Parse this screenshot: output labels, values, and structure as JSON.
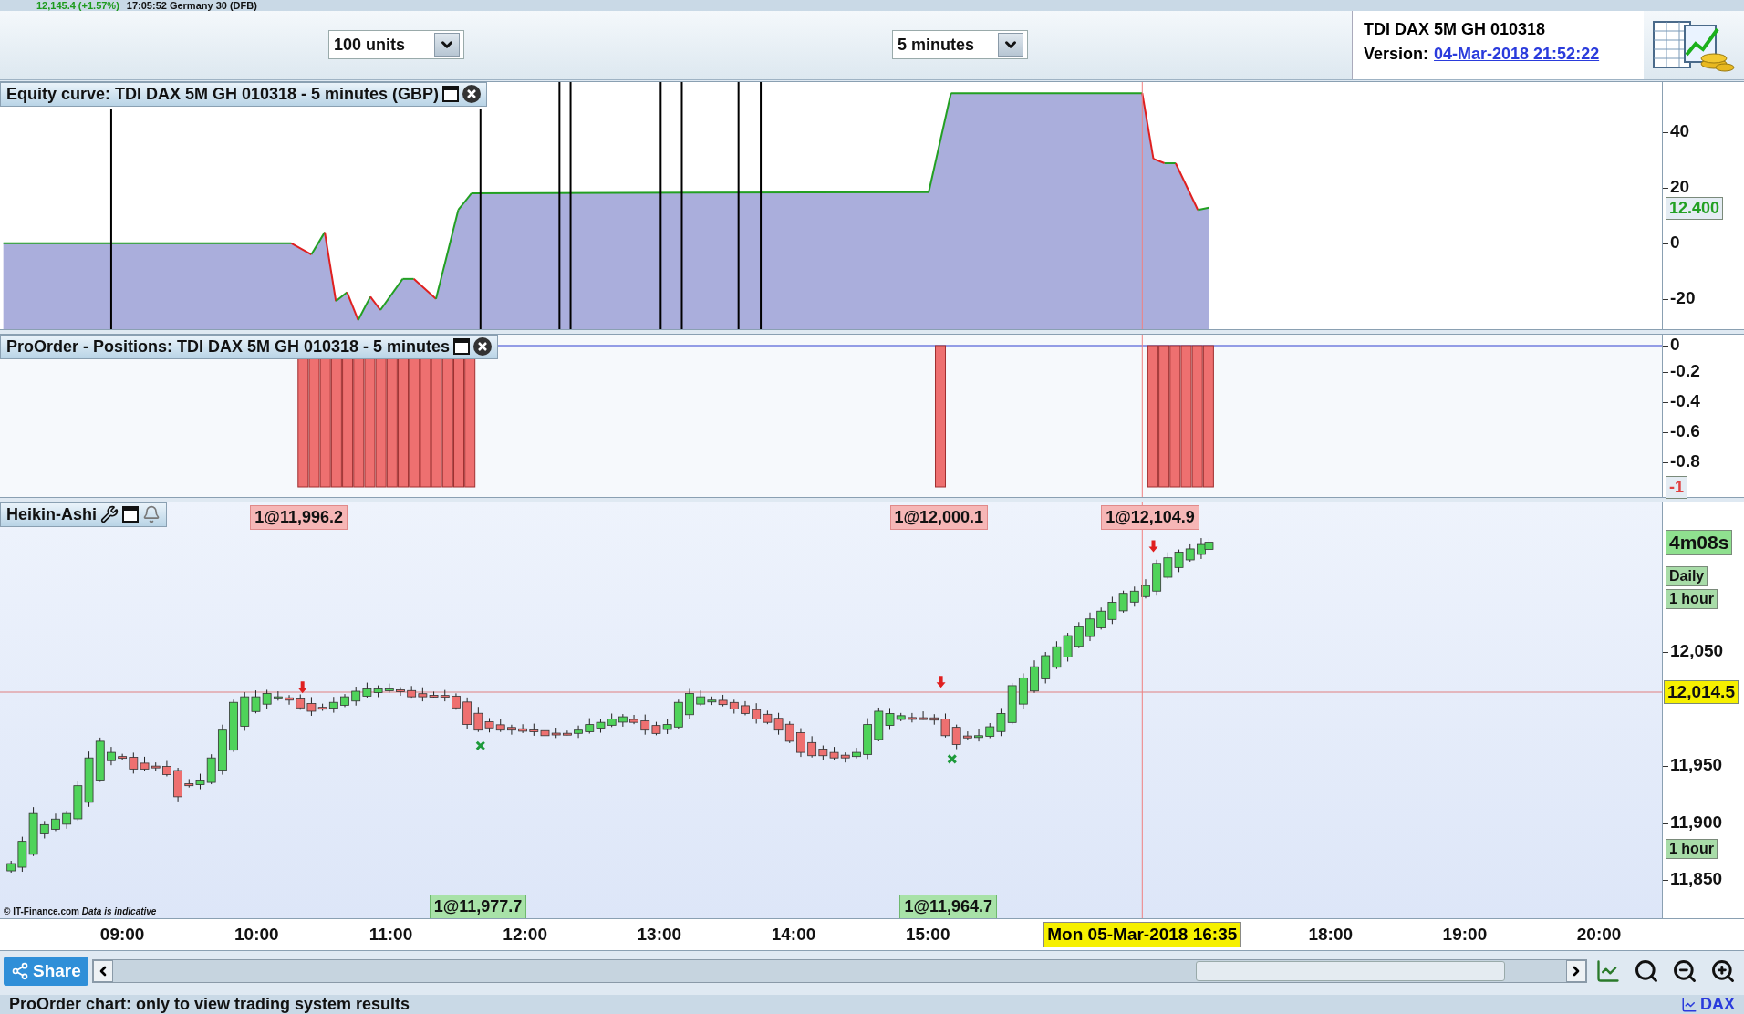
{
  "ticker": {
    "price": "12,145.4 (+1.57%)",
    "info": "17:05:52 Germany 30 (DFB)"
  },
  "toolbar": {
    "quantity": "100 units",
    "timeframe": "5 minutes",
    "system": {
      "name": "TDI DAX 5M GH 010318",
      "version_label": "Version:",
      "version": "04-Mar-2018 21:52:22"
    }
  },
  "equity_panel": {
    "title": "Equity curve: TDI DAX 5M GH 010318 - 5 minutes (GBP)",
    "yticks": [
      "40",
      "20",
      "0",
      "-20"
    ],
    "current_value": "12.400"
  },
  "positions_panel": {
    "title": "ProOrder - Positions: TDI DAX 5M GH 010318 - 5 minutes",
    "yticks": [
      "0",
      "-0.2",
      "-0.4",
      "-0.6",
      "-0.8"
    ],
    "current_value": "-1"
  },
  "price_panel": {
    "title": "Heikin-Ashi",
    "yticks": [
      "12,050",
      "11,950",
      "11,900",
      "11,850"
    ],
    "countdown": "4m08s",
    "period_labels": [
      "Daily",
      "1 hour",
      "1 hour"
    ],
    "current_price": "12,014.5",
    "orders": [
      {
        "text": "1@11,996.2",
        "kind": "sell"
      },
      {
        "text": "1@12,000.1",
        "kind": "sell"
      },
      {
        "text": "1@12,104.9",
        "kind": "sell"
      },
      {
        "text": "1@11,977.7",
        "kind": "buy"
      },
      {
        "text": "1@11,964.7",
        "kind": "buy"
      }
    ],
    "copyright": "© IT-Finance.com",
    "disclaimer": "Data is indicative"
  },
  "time_axis": {
    "ticks": [
      "09:00",
      "10:00",
      "11:00",
      "12:00",
      "13:00",
      "14:00",
      "15:00",
      "18:00",
      "19:00",
      "20:00"
    ],
    "cursor": "Mon 05-Mar-2018 16:35"
  },
  "share_button": "Share",
  "status_bar": {
    "message": "ProOrder chart: only to view trading system results",
    "instrument": "DAX"
  }
}
